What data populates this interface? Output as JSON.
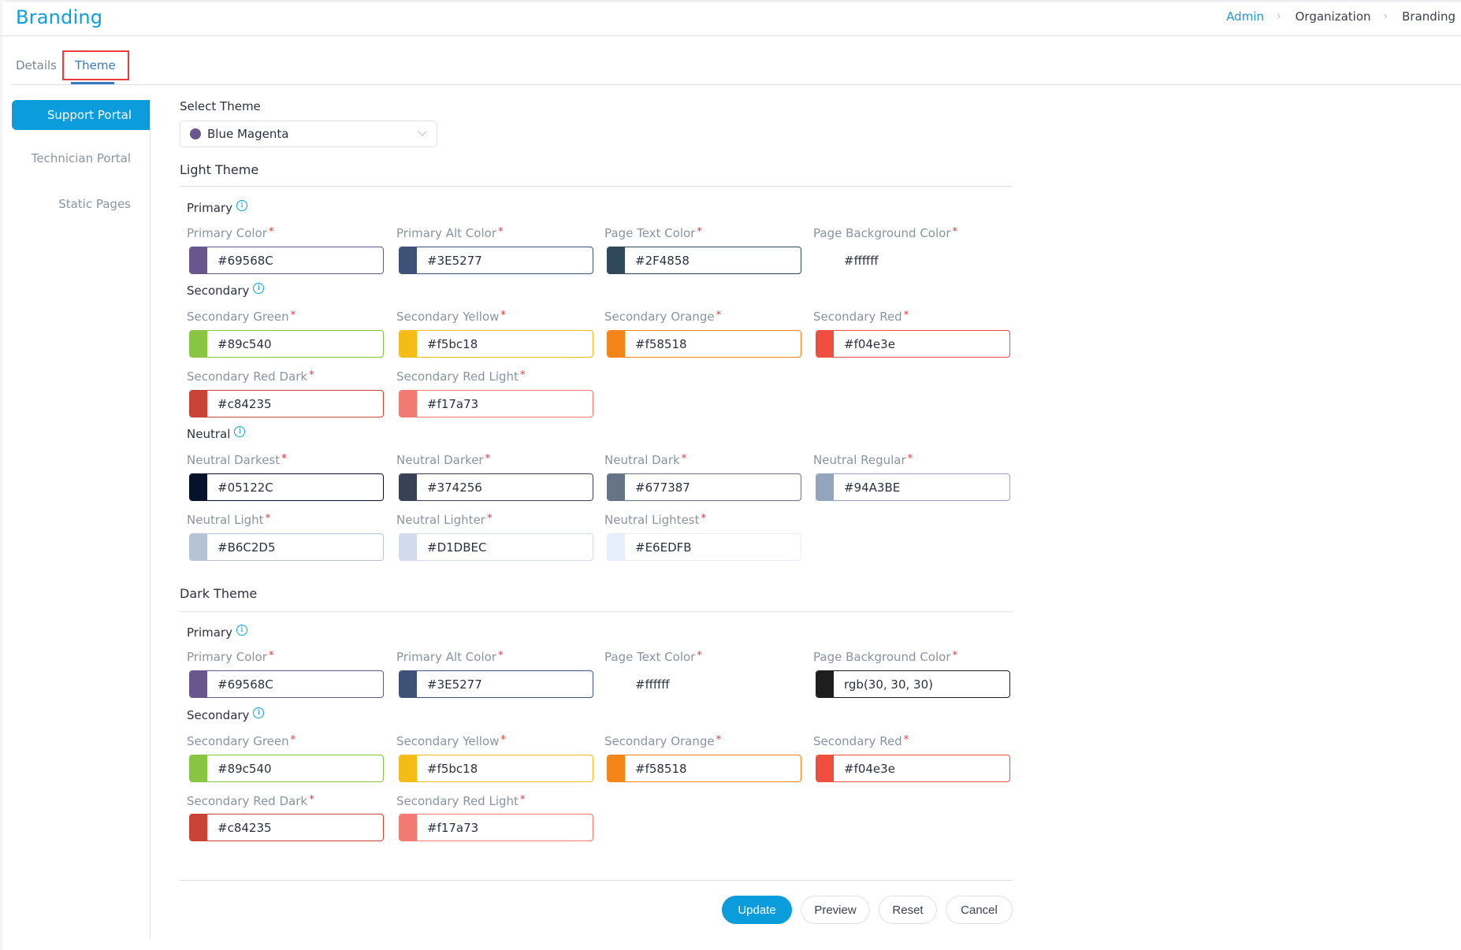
{
  "header": {
    "title": "Branding",
    "breadcrumb": [
      "Admin",
      "Organization",
      "Branding"
    ]
  },
  "tabs": [
    {
      "label": "Details",
      "active": false
    },
    {
      "label": "Theme",
      "active": true
    }
  ],
  "sidebar": {
    "items": [
      {
        "label": "Support Portal",
        "active": true
      },
      {
        "label": "Technician Portal",
        "active": false
      },
      {
        "label": "Static Pages",
        "active": false
      }
    ]
  },
  "select_theme": {
    "label": "Select Theme",
    "value": "Blue Magenta",
    "dot_color": "#69568C"
  },
  "accent_color": "#0a9cdb",
  "light_theme": {
    "title": "Light Theme",
    "groups": {
      "primary": "Primary",
      "secondary": "Secondary",
      "neutral": "Neutral"
    },
    "fields": {
      "primary_color": {
        "label": "Primary Color",
        "value": "#69568C",
        "swatch": "#69568C"
      },
      "primary_alt_color": {
        "label": "Primary Alt Color",
        "value": "#3E5277",
        "swatch": "#3E5277"
      },
      "page_text_color": {
        "label": "Page Text Color",
        "value": "#2F4858",
        "swatch": "#2F4858"
      },
      "page_background_color": {
        "label": "Page Background Color",
        "value": "#ffffff",
        "swatch": "#ffffff"
      },
      "secondary_green": {
        "label": "Secondary Green",
        "value": "#89c540",
        "swatch": "#89c540"
      },
      "secondary_yellow": {
        "label": "Secondary Yellow",
        "value": "#f5bc18",
        "swatch": "#f5bc18"
      },
      "secondary_orange": {
        "label": "Secondary Orange",
        "value": "#f58518",
        "swatch": "#f58518"
      },
      "secondary_red": {
        "label": "Secondary Red",
        "value": "#f04e3e",
        "swatch": "#f04e3e"
      },
      "secondary_red_dark": {
        "label": "Secondary Red Dark",
        "value": "#c84235",
        "swatch": "#c84235"
      },
      "secondary_red_light": {
        "label": "Secondary Red Light",
        "value": "#f17a73",
        "swatch": "#f17a73"
      },
      "neutral_darkest": {
        "label": "Neutral Darkest",
        "value": "#05122C",
        "swatch": "#05122C"
      },
      "neutral_darker": {
        "label": "Neutral Darker",
        "value": "#374256",
        "swatch": "#374256"
      },
      "neutral_dark": {
        "label": "Neutral Dark",
        "value": "#677387",
        "swatch": "#677387"
      },
      "neutral_regular": {
        "label": "Neutral Regular",
        "value": "#94A3BE",
        "swatch": "#94A3BE"
      },
      "neutral_light": {
        "label": "Neutral Light",
        "value": "#B6C2D5",
        "swatch": "#B6C2D5"
      },
      "neutral_lighter": {
        "label": "Neutral Lighter",
        "value": "#D1DBEC",
        "swatch": "#D1DBEC"
      },
      "neutral_lightest": {
        "label": "Neutral Lightest",
        "value": "#E6EDFB",
        "swatch": "#E6EDFB"
      }
    }
  },
  "dark_theme": {
    "title": "Dark Theme",
    "groups": {
      "primary": "Primary",
      "secondary": "Secondary"
    },
    "fields": {
      "primary_color": {
        "label": "Primary Color",
        "value": "#69568C",
        "swatch": "#69568C"
      },
      "primary_alt_color": {
        "label": "Primary Alt Color",
        "value": "#3E5277",
        "swatch": "#3E5277"
      },
      "page_text_color": {
        "label": "Page Text Color",
        "value": "#ffffff",
        "swatch": "#ffffff"
      },
      "page_background_color": {
        "label": "Page Background Color",
        "value": "rgb(30, 30, 30)",
        "swatch": "#1e1e1e"
      },
      "secondary_green": {
        "label": "Secondary Green",
        "value": "#89c540",
        "swatch": "#89c540"
      },
      "secondary_yellow": {
        "label": "Secondary Yellow",
        "value": "#f5bc18",
        "swatch": "#f5bc18"
      },
      "secondary_orange": {
        "label": "Secondary Orange",
        "value": "#f58518",
        "swatch": "#f58518"
      },
      "secondary_red": {
        "label": "Secondary Red",
        "value": "#f04e3e",
        "swatch": "#f04e3e"
      },
      "secondary_red_dark": {
        "label": "Secondary Red Dark",
        "value": "#c84235",
        "swatch": "#c84235"
      },
      "secondary_red_light": {
        "label": "Secondary Red Light",
        "value": "#f17a73",
        "swatch": "#f17a73"
      }
    }
  },
  "required_marker": "*",
  "info_glyph": "i",
  "actions": {
    "update": "Update",
    "preview": "Preview",
    "reset": "Reset",
    "cancel": "Cancel"
  }
}
